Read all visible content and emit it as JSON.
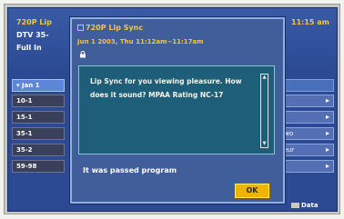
{
  "guide": {
    "channel_title": "720P Lip",
    "line2": "DTV 35-",
    "line3": "Full In",
    "time": "11:15 am",
    "date_bar": "Jan 1",
    "rows": [
      "10-1",
      "15-1",
      "35-1",
      "35-2",
      "59-98"
    ],
    "cells": [
      "",
      "",
      "Two",
      "feur",
      ""
    ],
    "data_button": "Data"
  },
  "dialog": {
    "title": "720P Lip Sync",
    "datetime": "Jun 1 2003, Thu 11:12am~11:17am",
    "description": "Lip Sync for you viewing pleasure. How does it sound? MPAA Rating NC-17",
    "status": "It was passed program",
    "ok_label": "OK"
  },
  "colors": {
    "accent": "#f3c640",
    "dialog_bg": "#3f5e9a",
    "description_bg": "#1f5e78",
    "ok_button": "#f0b400"
  },
  "icons": [
    "lock-icon",
    "right-arrow-icon",
    "scroll-up-icon",
    "scroll-down-icon"
  ]
}
